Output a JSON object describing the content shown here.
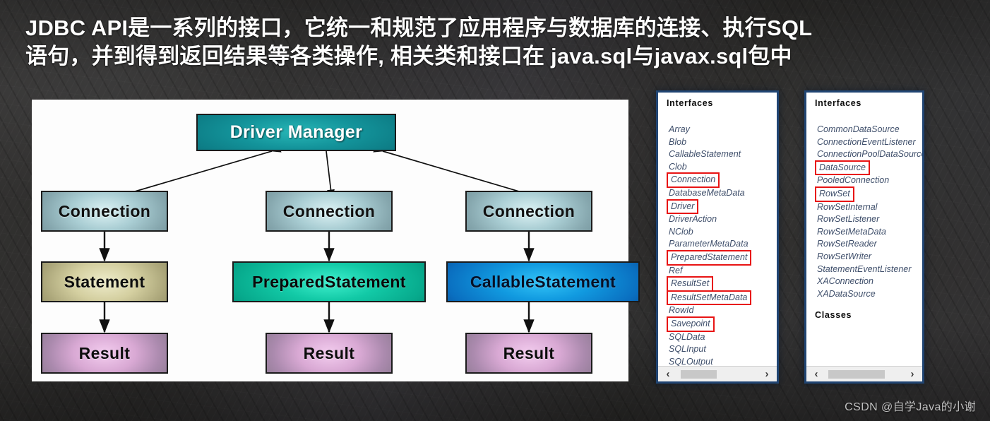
{
  "slide": {
    "title_line1": "JDBC API是一系列的接口，它统一和规范了应用程序与数据库的连接、执行SQL",
    "title_line2": "语句，并到得到返回结果等各类操作, 相关类和接口在 java.sql与javax.sql包中",
    "watermark": "CSDN @自学Java的小谢",
    "accent_red": "#e81414",
    "panel_border_blue": "#214b80",
    "background": "#2f2e2d"
  },
  "diagram": {
    "driver_manager": "Driver Manager",
    "columns": [
      {
        "connection": "Connection",
        "statement": "Statement",
        "result": "Result"
      },
      {
        "connection": "Connection",
        "statement": "PreparedStatement",
        "result": "Result"
      },
      {
        "connection": "Connection",
        "statement": "CallableStatement",
        "result": "Result"
      }
    ]
  },
  "panels": [
    {
      "heading": "Interfaces",
      "items": [
        {
          "label": "Array",
          "highlighted": false
        },
        {
          "label": "Blob",
          "highlighted": false
        },
        {
          "label": "CallableStatement",
          "highlighted": false
        },
        {
          "label": "Clob",
          "highlighted": false
        },
        {
          "label": "Connection",
          "highlighted": true
        },
        {
          "label": "DatabaseMetaData",
          "highlighted": false
        },
        {
          "label": "Driver",
          "highlighted": true
        },
        {
          "label": "DriverAction",
          "highlighted": false
        },
        {
          "label": "NClob",
          "highlighted": false
        },
        {
          "label": "ParameterMetaData",
          "highlighted": false
        },
        {
          "label": "PreparedStatement",
          "highlighted": true
        },
        {
          "label": "Ref",
          "highlighted": false
        },
        {
          "label": "ResultSet",
          "highlighted": true
        },
        {
          "label": "ResultSetMetaData",
          "highlighted": true
        },
        {
          "label": "RowId",
          "highlighted": false
        },
        {
          "label": "Savepoint",
          "highlighted": true
        },
        {
          "label": "SQLData",
          "highlighted": false
        },
        {
          "label": "SQLInput",
          "highlighted": false
        },
        {
          "label": "SQLOutput",
          "highlighted": false
        }
      ],
      "scrollbar": {
        "left_arrow": "‹",
        "right_arrow": "›",
        "thumb_left_pct": 4,
        "thumb_width_pct": 45
      }
    },
    {
      "heading": "Interfaces",
      "second_heading": "Classes",
      "items": [
        {
          "label": "CommonDataSource",
          "highlighted": false
        },
        {
          "label": "ConnectionEventListener",
          "highlighted": false
        },
        {
          "label": "ConnectionPoolDataSource",
          "highlighted": false
        },
        {
          "label": "DataSource",
          "highlighted": true
        },
        {
          "label": "PooledConnection",
          "highlighted": false
        },
        {
          "label": "RowSet",
          "highlighted": true
        },
        {
          "label": "RowSetInternal",
          "highlighted": false
        },
        {
          "label": "RowSetListener",
          "highlighted": false
        },
        {
          "label": "RowSetMetaData",
          "highlighted": false
        },
        {
          "label": "RowSetReader",
          "highlighted": false
        },
        {
          "label": "RowSetWriter",
          "highlighted": false
        },
        {
          "label": "StatementEventListener",
          "highlighted": false
        },
        {
          "label": "XAConnection",
          "highlighted": false
        },
        {
          "label": "XADataSource",
          "highlighted": false
        }
      ],
      "scrollbar": {
        "left_arrow": "‹",
        "right_arrow": "›",
        "thumb_left_pct": 4,
        "thumb_width_pct": 72
      }
    }
  ]
}
